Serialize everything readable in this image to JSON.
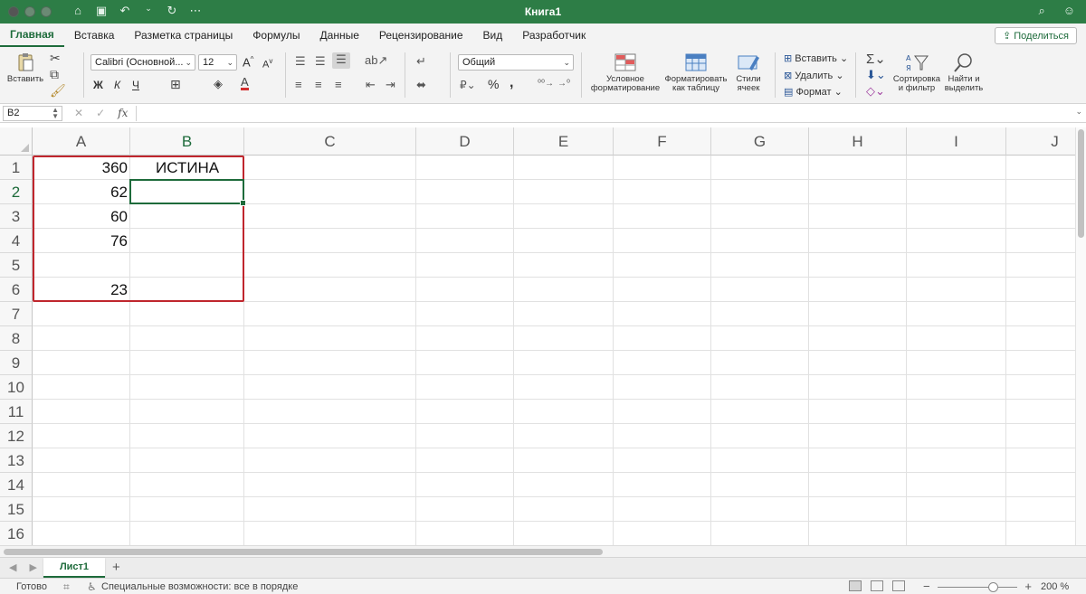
{
  "window": {
    "title": "Книга1"
  },
  "ribbon_tabs": [
    "Главная",
    "Вставка",
    "Разметка страницы",
    "Формулы",
    "Данные",
    "Рецензирование",
    "Вид",
    "Разработчик"
  ],
  "share_label": "Поделиться",
  "clipboard": {
    "paste_label": "Вставить"
  },
  "font": {
    "name": "Calibri (Основной...",
    "size": "12",
    "bold": "Ж",
    "italic": "К",
    "underline": "Ч",
    "grow": "A",
    "shrink": "A",
    "font_color_letter": "A"
  },
  "number_format": {
    "value": "Общий",
    "percent": "%",
    "comma": ","
  },
  "styles": {
    "conditional": "Условное форматирование",
    "format_table": "Форматировать как таблицу",
    "cell_styles": "Стили ячеек"
  },
  "cells_group": {
    "insert": "Вставить",
    "delete": "Удалить",
    "format": "Формат"
  },
  "editing": {
    "sort_filter": "Сортировка и фильтр",
    "find_select": "Найти и выделить"
  },
  "formula_bar": {
    "name_box": "B2",
    "fx": "fx",
    "formula": ""
  },
  "columns": [
    "A",
    "B",
    "C",
    "D",
    "E",
    "F",
    "G",
    "H",
    "I",
    "J"
  ],
  "selected_column": "B",
  "rows": [
    "1",
    "2",
    "3",
    "4",
    "5",
    "6",
    "7",
    "8",
    "9",
    "10",
    "11",
    "12",
    "13",
    "14",
    "15",
    "16"
  ],
  "selected_row": "2",
  "cells": {
    "A1": "360",
    "B1": "ИСТИНА",
    "A2": "62",
    "B2": "",
    "A3": "60",
    "A4": "76",
    "A5": "",
    "A6": "23"
  },
  "active_cell": "B2",
  "highlight_range": "A1:B6",
  "sheets": [
    {
      "name": "Лист1",
      "active": true
    }
  ],
  "status": {
    "ready": "Готово",
    "accessibility": "Специальные возможности: все в порядке",
    "zoom": "200 %"
  },
  "colors": {
    "accent": "#1e6b3b",
    "titlebar": "#2d7d46",
    "highlight": "#c0262d"
  }
}
